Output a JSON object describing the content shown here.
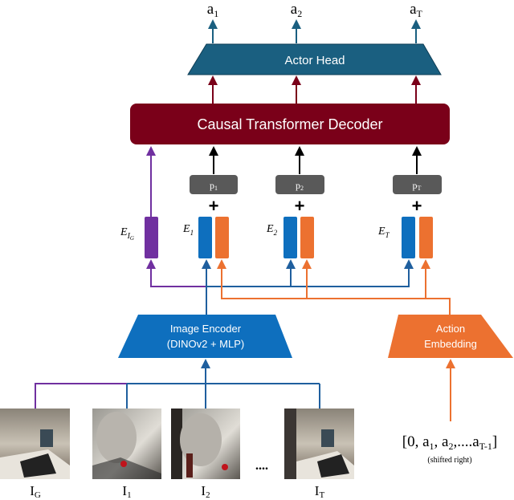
{
  "colors": {
    "actor_head": "#1a5f80",
    "decoder": "#7a0019",
    "image_encoder": "#0e6fbe",
    "action_embedding": "#ec7130",
    "goal": "#7030a0",
    "position": "#595959"
  },
  "outputs": [
    {
      "base": "a",
      "sub": "1"
    },
    {
      "base": "a",
      "sub": "2"
    },
    {
      "base": "a",
      "sub": "T"
    }
  ],
  "actor_head": {
    "label": "Actor Head"
  },
  "decoder": {
    "label": "Causal Transformer Decoder"
  },
  "positions": [
    {
      "base": "p",
      "sub": "1"
    },
    {
      "base": "p",
      "sub": "2"
    },
    {
      "base": "p",
      "sub": "T"
    }
  ],
  "plus": "+",
  "embeddings": {
    "goal": {
      "base": "E",
      "sub": "I",
      "subsub": "G"
    },
    "steps": [
      {
        "base": "E",
        "sub": "1"
      },
      {
        "base": "E",
        "sub": "2"
      },
      {
        "base": "E",
        "sub": "T"
      }
    ]
  },
  "image_encoder": {
    "line1": "Image Encoder",
    "line2": "(DINOv2 + MLP)"
  },
  "action_embedding": {
    "line1": "Action",
    "line2": "Embedding"
  },
  "images": [
    {
      "base": "I",
      "sub": "G"
    },
    {
      "base": "I",
      "sub": "1"
    },
    {
      "base": "I",
      "sub": "2"
    },
    {
      "base": "I",
      "sub": "T"
    }
  ],
  "ellipsis": "....",
  "action_sequence": {
    "open": "[0, ",
    "items": [
      {
        "base": "a",
        "sub": "1",
        "sep": ", "
      },
      {
        "base": "a",
        "sub": "2",
        "sep": ",...."
      },
      {
        "base": "a",
        "sub": "T-1",
        "sep": "]"
      }
    ],
    "note": "(shifted right)"
  }
}
